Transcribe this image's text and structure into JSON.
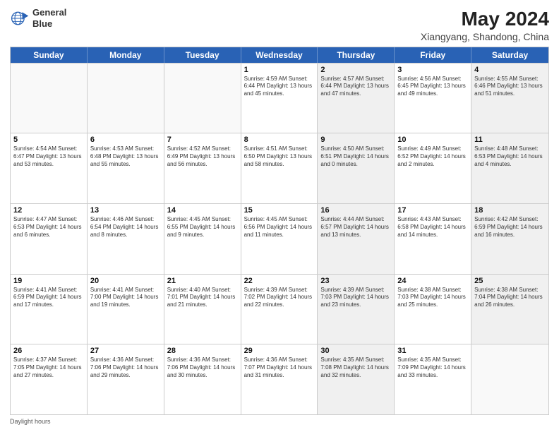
{
  "header": {
    "logo_line1": "General",
    "logo_line2": "Blue",
    "title": "May 2024",
    "subtitle": "Xiangyang, Shandong, China"
  },
  "calendar": {
    "days_of_week": [
      "Sunday",
      "Monday",
      "Tuesday",
      "Wednesday",
      "Thursday",
      "Friday",
      "Saturday"
    ],
    "rows": [
      [
        {
          "day": "",
          "info": "",
          "empty": true
        },
        {
          "day": "",
          "info": "",
          "empty": true
        },
        {
          "day": "",
          "info": "",
          "empty": true
        },
        {
          "day": "1",
          "info": "Sunrise: 4:59 AM\nSunset: 6:44 PM\nDaylight: 13 hours\nand 45 minutes.",
          "empty": false,
          "shaded": false
        },
        {
          "day": "2",
          "info": "Sunrise: 4:57 AM\nSunset: 6:44 PM\nDaylight: 13 hours\nand 47 minutes.",
          "empty": false,
          "shaded": true
        },
        {
          "day": "3",
          "info": "Sunrise: 4:56 AM\nSunset: 6:45 PM\nDaylight: 13 hours\nand 49 minutes.",
          "empty": false,
          "shaded": false
        },
        {
          "day": "4",
          "info": "Sunrise: 4:55 AM\nSunset: 6:46 PM\nDaylight: 13 hours\nand 51 minutes.",
          "empty": false,
          "shaded": true
        }
      ],
      [
        {
          "day": "5",
          "info": "Sunrise: 4:54 AM\nSunset: 6:47 PM\nDaylight: 13 hours\nand 53 minutes.",
          "empty": false,
          "shaded": false
        },
        {
          "day": "6",
          "info": "Sunrise: 4:53 AM\nSunset: 6:48 PM\nDaylight: 13 hours\nand 55 minutes.",
          "empty": false,
          "shaded": false
        },
        {
          "day": "7",
          "info": "Sunrise: 4:52 AM\nSunset: 6:49 PM\nDaylight: 13 hours\nand 56 minutes.",
          "empty": false,
          "shaded": false
        },
        {
          "day": "8",
          "info": "Sunrise: 4:51 AM\nSunset: 6:50 PM\nDaylight: 13 hours\nand 58 minutes.",
          "empty": false,
          "shaded": false
        },
        {
          "day": "9",
          "info": "Sunrise: 4:50 AM\nSunset: 6:51 PM\nDaylight: 14 hours\nand 0 minutes.",
          "empty": false,
          "shaded": true
        },
        {
          "day": "10",
          "info": "Sunrise: 4:49 AM\nSunset: 6:52 PM\nDaylight: 14 hours\nand 2 minutes.",
          "empty": false,
          "shaded": false
        },
        {
          "day": "11",
          "info": "Sunrise: 4:48 AM\nSunset: 6:53 PM\nDaylight: 14 hours\nand 4 minutes.",
          "empty": false,
          "shaded": true
        }
      ],
      [
        {
          "day": "12",
          "info": "Sunrise: 4:47 AM\nSunset: 6:53 PM\nDaylight: 14 hours\nand 6 minutes.",
          "empty": false,
          "shaded": false
        },
        {
          "day": "13",
          "info": "Sunrise: 4:46 AM\nSunset: 6:54 PM\nDaylight: 14 hours\nand 8 minutes.",
          "empty": false,
          "shaded": false
        },
        {
          "day": "14",
          "info": "Sunrise: 4:45 AM\nSunset: 6:55 PM\nDaylight: 14 hours\nand 9 minutes.",
          "empty": false,
          "shaded": false
        },
        {
          "day": "15",
          "info": "Sunrise: 4:45 AM\nSunset: 6:56 PM\nDaylight: 14 hours\nand 11 minutes.",
          "empty": false,
          "shaded": false
        },
        {
          "day": "16",
          "info": "Sunrise: 4:44 AM\nSunset: 6:57 PM\nDaylight: 14 hours\nand 13 minutes.",
          "empty": false,
          "shaded": true
        },
        {
          "day": "17",
          "info": "Sunrise: 4:43 AM\nSunset: 6:58 PM\nDaylight: 14 hours\nand 14 minutes.",
          "empty": false,
          "shaded": false
        },
        {
          "day": "18",
          "info": "Sunrise: 4:42 AM\nSunset: 6:59 PM\nDaylight: 14 hours\nand 16 minutes.",
          "empty": false,
          "shaded": true
        }
      ],
      [
        {
          "day": "19",
          "info": "Sunrise: 4:41 AM\nSunset: 6:59 PM\nDaylight: 14 hours\nand 17 minutes.",
          "empty": false,
          "shaded": false
        },
        {
          "day": "20",
          "info": "Sunrise: 4:41 AM\nSunset: 7:00 PM\nDaylight: 14 hours\nand 19 minutes.",
          "empty": false,
          "shaded": false
        },
        {
          "day": "21",
          "info": "Sunrise: 4:40 AM\nSunset: 7:01 PM\nDaylight: 14 hours\nand 21 minutes.",
          "empty": false,
          "shaded": false
        },
        {
          "day": "22",
          "info": "Sunrise: 4:39 AM\nSunset: 7:02 PM\nDaylight: 14 hours\nand 22 minutes.",
          "empty": false,
          "shaded": false
        },
        {
          "day": "23",
          "info": "Sunrise: 4:39 AM\nSunset: 7:03 PM\nDaylight: 14 hours\nand 23 minutes.",
          "empty": false,
          "shaded": true
        },
        {
          "day": "24",
          "info": "Sunrise: 4:38 AM\nSunset: 7:03 PM\nDaylight: 14 hours\nand 25 minutes.",
          "empty": false,
          "shaded": false
        },
        {
          "day": "25",
          "info": "Sunrise: 4:38 AM\nSunset: 7:04 PM\nDaylight: 14 hours\nand 26 minutes.",
          "empty": false,
          "shaded": true
        }
      ],
      [
        {
          "day": "26",
          "info": "Sunrise: 4:37 AM\nSunset: 7:05 PM\nDaylight: 14 hours\nand 27 minutes.",
          "empty": false,
          "shaded": false
        },
        {
          "day": "27",
          "info": "Sunrise: 4:36 AM\nSunset: 7:06 PM\nDaylight: 14 hours\nand 29 minutes.",
          "empty": false,
          "shaded": false
        },
        {
          "day": "28",
          "info": "Sunrise: 4:36 AM\nSunset: 7:06 PM\nDaylight: 14 hours\nand 30 minutes.",
          "empty": false,
          "shaded": false
        },
        {
          "day": "29",
          "info": "Sunrise: 4:36 AM\nSunset: 7:07 PM\nDaylight: 14 hours\nand 31 minutes.",
          "empty": false,
          "shaded": false
        },
        {
          "day": "30",
          "info": "Sunrise: 4:35 AM\nSunset: 7:08 PM\nDaylight: 14 hours\nand 32 minutes.",
          "empty": false,
          "shaded": true
        },
        {
          "day": "31",
          "info": "Sunrise: 4:35 AM\nSunset: 7:09 PM\nDaylight: 14 hours\nand 33 minutes.",
          "empty": false,
          "shaded": false
        },
        {
          "day": "",
          "info": "",
          "empty": true,
          "shaded": true
        }
      ]
    ]
  },
  "footer": {
    "text": "Daylight hours"
  }
}
